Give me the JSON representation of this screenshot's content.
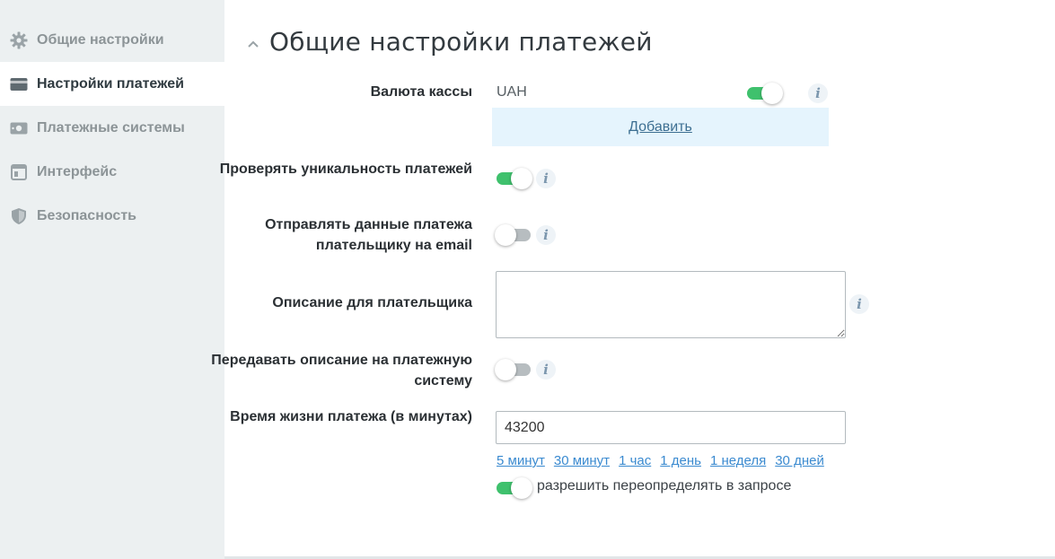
{
  "sidebar": {
    "items": [
      {
        "label": "Общие настройки",
        "icon": "gear-icon",
        "active": false
      },
      {
        "label": "Настройки платежей",
        "icon": "card-icon",
        "active": true
      },
      {
        "label": "Платежные системы",
        "icon": "cash-icon",
        "active": false
      },
      {
        "label": "Интерфейс",
        "icon": "window-icon",
        "active": false
      },
      {
        "label": "Безопасность",
        "icon": "shield-icon",
        "active": false
      }
    ]
  },
  "main": {
    "title": "Общие настройки платежей",
    "currency": {
      "label": "Валюта кассы",
      "value": "UAH",
      "enabled": true,
      "add_label": "Добавить"
    },
    "check_unique": {
      "label": "Проверять уникальность платежей",
      "enabled": true
    },
    "send_email": {
      "label": "Отправлять данные платежа плательщику на email",
      "enabled": false
    },
    "description": {
      "label": "Описание для плательщика",
      "value": ""
    },
    "pass_description": {
      "label": "Передавать описание на платежную систему",
      "enabled": false
    },
    "lifetime": {
      "label": "Время жизни платежа (в минутах)",
      "value": "43200",
      "presets": [
        "5 минут",
        "30 минут",
        "1 час",
        "1 день",
        "1 неделя",
        "30 дней"
      ],
      "override": {
        "label": "разрешить переопределять в запросе",
        "enabled": true
      }
    },
    "info_glyph": "i"
  },
  "colors": {
    "sidebar_bg": "#ecf0f1",
    "toggle_on": "#3fc16d",
    "toggle_off": "#b7bdc0",
    "link": "#3a8ad0",
    "add_block_bg": "#e5f4fd"
  }
}
